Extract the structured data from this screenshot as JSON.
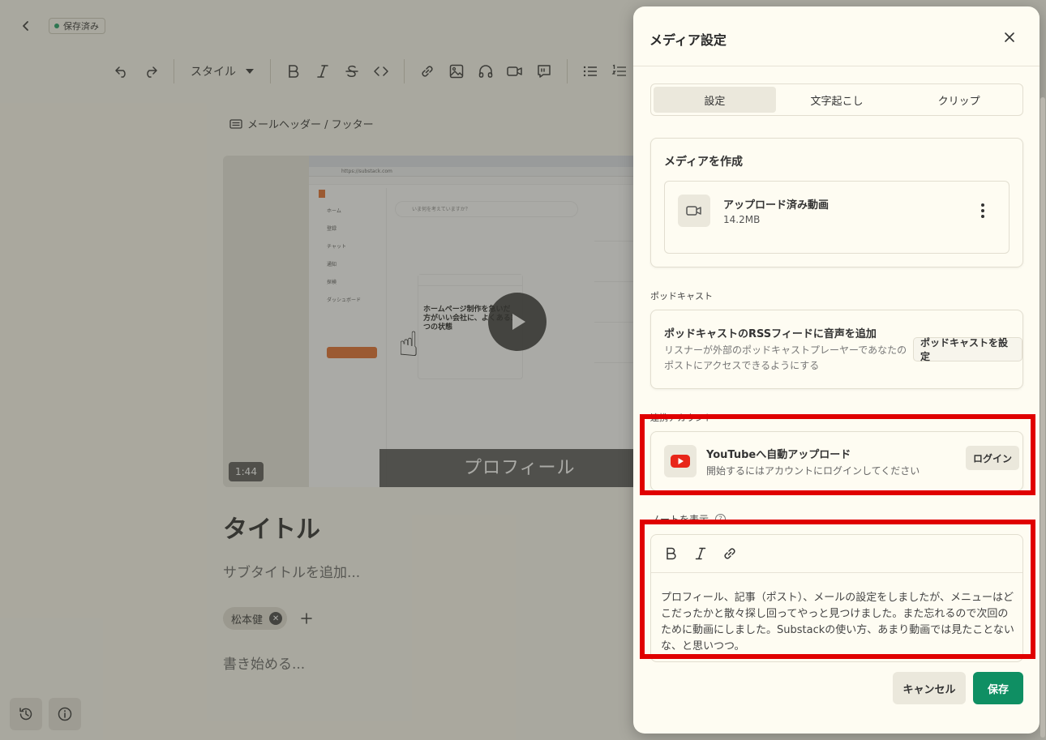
{
  "editor": {
    "saved_label": "保存済み",
    "toolbar": {
      "style_label": "スタイル"
    },
    "mail_header_label": "メールヘッダー / フッター",
    "video": {
      "duration": "1:44",
      "caption": "プロフィール",
      "screenshot_url": "https://substack.com",
      "screenshot_compose": "いま何を考えていますか？",
      "screenshot_post_title": "ホームページ制作を急いだ方がいい会社に、よくある3つの状態",
      "screenshot_nav": [
        "ホーム",
        "登録",
        "チャット",
        "通知",
        "探検",
        "ダッシュボード"
      ]
    },
    "title": "タイトル",
    "subtitle_placeholder": "サブタイトルを追加...",
    "author_name": "松本健",
    "body_placeholder": "書き始める..."
  },
  "modal": {
    "title": "メディア設定",
    "tabs": [
      {
        "label": "設定",
        "active": true
      },
      {
        "label": "文字起こし",
        "active": false
      },
      {
        "label": "クリップ",
        "active": false
      }
    ],
    "media_section": {
      "heading": "メディアを作成",
      "file_name": "アップロード済み動画",
      "file_size": "14.2MB"
    },
    "podcast_section": {
      "label": "ポッドキャスト",
      "title": "ポッドキャストのRSSフィードに音声を追加",
      "description": "リスナーが外部のポッドキャストプレーヤーであなたのポストにアクセスできるようにする",
      "button": "ポッドキャストを設定"
    },
    "linked_section": {
      "label": "連携アカウント",
      "youtube_title": "YouTubeへ自動アップロード",
      "youtube_desc": "開始するにはアカウントにログインしてください",
      "login_button": "ログイン"
    },
    "note_section": {
      "label": "ノートを表示",
      "help_glyph": "?",
      "text": "プロフィール、記事（ポスト）、メールの設定をしましたが、メニューはどこだったかと散々探し回ってやっと見つけました。また忘れるので次回のために動画にしました。Substackの使い方、あまり動画では見たことないな、と思いつつ。"
    },
    "footer": {
      "cancel": "キャンセル",
      "save": "保存"
    }
  },
  "colors": {
    "accent": "#0f8f63",
    "highlight": "#e00000",
    "youtube": "#e8261a"
  }
}
